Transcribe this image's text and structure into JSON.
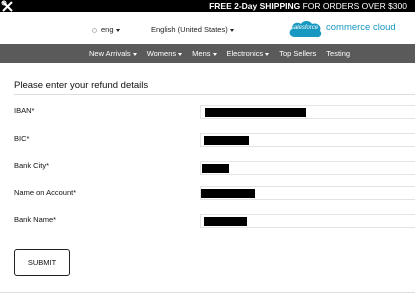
{
  "promo": {
    "text_bold": "FREE 2-Day SHIPPING",
    "text_rest": " FOR ORDERS OVER $300",
    "icon": "tools-icon"
  },
  "header": {
    "language": "eng",
    "locale": "English (United States)",
    "logo_cloud_text": "salesforce",
    "logo_text": "commerce cloud"
  },
  "nav": {
    "items": [
      {
        "label": "New Arrivals",
        "has_dropdown": true
      },
      {
        "label": "Womens",
        "has_dropdown": true
      },
      {
        "label": "Mens",
        "has_dropdown": true
      },
      {
        "label": "Electronics",
        "has_dropdown": true
      },
      {
        "label": "Top Sellers",
        "has_dropdown": false
      },
      {
        "label": "Testing",
        "has_dropdown": false
      }
    ]
  },
  "form": {
    "title": "Please enter your refund details",
    "fields": [
      {
        "label": "IBAN*",
        "value_redacted": true
      },
      {
        "label": "BIC*",
        "value_redacted": true
      },
      {
        "label": "Bank City*",
        "value_redacted": true
      },
      {
        "label": "Name on Account*",
        "value_redacted": true
      },
      {
        "label": "Bank Name*",
        "value_redacted": true
      }
    ],
    "submit_label": "SUBMIT"
  },
  "colors": {
    "promo_bg": "#000000",
    "nav_bg": "#5a5a5a",
    "brand_blue": "#1798c1"
  }
}
